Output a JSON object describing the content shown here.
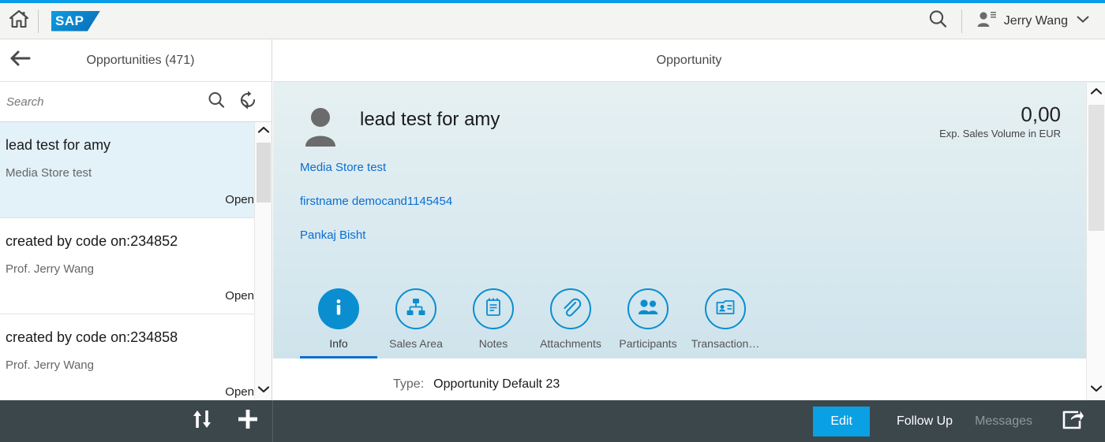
{
  "theme": {
    "accent_bar": "#0a9ce8",
    "brand_blue": "#0a8ed0",
    "link_blue": "#0a6ed1",
    "footer_bg": "#3c474c",
    "edit_button_bg": "#0aa0e4",
    "selected_row_bg": "#e3f1f9"
  },
  "shell_header": {
    "home_icon": "home-icon",
    "logo_text": "SAP",
    "search_icon": "search-icon",
    "user_icon": "user-icon",
    "user_name": "Jerry Wang",
    "chevron_icon": "chevron-down-icon"
  },
  "master": {
    "back_icon": "arrow-left-icon",
    "title": "Opportunities (471)",
    "search": {
      "placeholder": "Search",
      "value": "",
      "search_icon": "search-icon",
      "refresh_icon": "refresh-icon"
    },
    "scrollbar": {
      "up_icon": "chevron-up-icon",
      "down_icon": "chevron-down-icon"
    },
    "items": [
      {
        "title": "lead test for amy",
        "subtitle": "Media Store test",
        "status": "Open",
        "selected": true
      },
      {
        "title": "created by code on:234852",
        "subtitle": "Prof. Jerry Wang",
        "status": "Open",
        "selected": false
      },
      {
        "title": "created by code on:234858",
        "subtitle": "Prof. Jerry Wang",
        "status": "Open",
        "selected": false
      }
    ]
  },
  "detail": {
    "title": "Opportunity",
    "hero": {
      "avatar_icon": "person-avatar-icon",
      "name": "lead test for amy",
      "kpi_value": "0,00",
      "kpi_label": "Exp. Sales Volume in EUR",
      "links": [
        {
          "label": "Media Store test"
        },
        {
          "label": "firstname democand1145454"
        },
        {
          "label": "Pankaj Bisht"
        }
      ]
    },
    "tabs": [
      {
        "label": "Info",
        "icon": "info-icon",
        "active": true
      },
      {
        "label": "Sales Area",
        "icon": "org-chart-icon",
        "active": false
      },
      {
        "label": "Notes",
        "icon": "notepad-icon",
        "active": false
      },
      {
        "label": "Attachments",
        "icon": "paperclip-icon",
        "active": false
      },
      {
        "label": "Participants",
        "icon": "people-icon",
        "active": false
      },
      {
        "label": "Transaction…",
        "icon": "contact-card-icon",
        "active": false
      }
    ],
    "fields": [
      {
        "label": "Type:",
        "value": "Opportunity Default 23"
      }
    ],
    "scrollbar": {
      "up_icon": "chevron-up-icon",
      "down_icon": "chevron-down-icon"
    }
  },
  "footer": {
    "sort_icon": "sort-icon",
    "add_icon": "plus-icon",
    "edit_label": "Edit",
    "follow_up_label": "Follow Up",
    "messages_label": "Messages",
    "share_icon": "share-icon"
  }
}
